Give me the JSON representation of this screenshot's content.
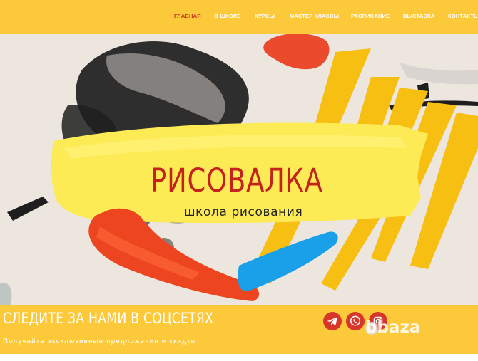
{
  "nav": {
    "items": [
      {
        "label": "ГЛАВНАЯ",
        "active": true
      },
      {
        "label": "О ШКОЛЕ",
        "active": false
      },
      {
        "label": "КУРСЫ",
        "active": false
      },
      {
        "label": "МАСТЕР КЛАССЫ",
        "active": false
      },
      {
        "label": "РАСПИСАНИЕ",
        "active": false
      },
      {
        "label": "ВЫСТАВКА",
        "active": false
      },
      {
        "label": "КОНТАКТЫ",
        "active": false
      }
    ]
  },
  "hero": {
    "title": "РИСОВАЛКА",
    "subtitle": "школа рисования"
  },
  "social": {
    "title": "СЛЕДИТЕ ЗА НАМИ В СОЦСЕТЯХ",
    "subtitle": "Получайте эксклюзивные предложения и скидки",
    "icons": [
      "telegram-icon",
      "whatsapp-icon",
      "instagram-icon"
    ]
  },
  "watermark": "bbaza",
  "colors": {
    "header_bg": "#fcc93a",
    "active_nav": "#c8301f",
    "title_red": "#c4221d",
    "social_button": "#d6372a"
  }
}
